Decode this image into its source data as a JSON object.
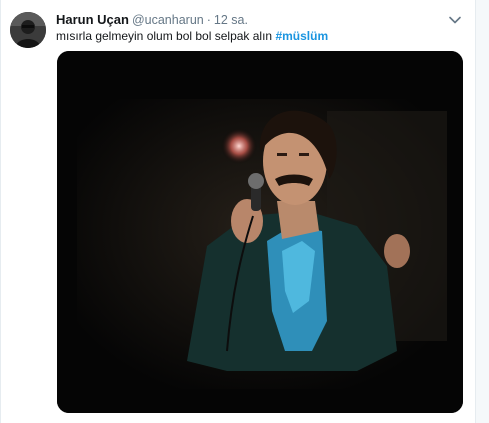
{
  "tweet": {
    "display_name": "Harun Uçan",
    "handle": "@ucanharun",
    "separator": "·",
    "timestamp": "12 sa.",
    "text": "mısırla gelmeyin olum bol bol selpak alın",
    "hashtag": "#müslüm",
    "menu_icon": "chevron-down-icon",
    "media_icon": "video-still"
  },
  "colors": {
    "link": "#1b95e0",
    "secondary_text": "#657786",
    "border": "#e6ecf0"
  }
}
